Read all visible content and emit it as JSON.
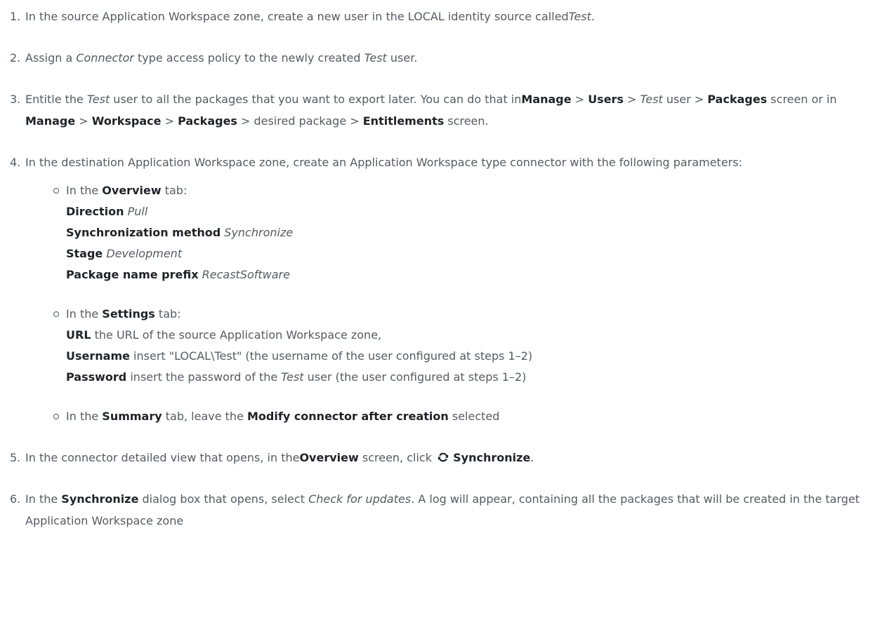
{
  "steps": [
    {
      "num": "1.",
      "t1": "In the source Application Workspace zone, create a new user in the LOCAL identity source called",
      "t2": "Test",
      "t3": "."
    },
    {
      "num": "2.",
      "t1": "Assign a ",
      "t2": "Connector",
      "t3": " type access policy to the newly created ",
      "t4": "Test",
      "t5": " user."
    },
    {
      "num": "3.",
      "t1": "Entitle the ",
      "t2": "Test",
      "t3": " user to all the packages that you want to export later. You can do that in",
      "manage1": "Manage",
      "sep": " > ",
      "users": "Users",
      "test": "Test",
      "user_text": " user > ",
      "packages1": "Packages",
      "t4": " screen or in ",
      "manage2": "Manage",
      "workspace": "Workspace",
      "packages2": "Packages",
      "t5": " > desired package > ",
      "entitlements": "Entitlements",
      "t6": " screen."
    },
    {
      "num": "4.",
      "t1": "In the destination Application Workspace zone, create an Application Workspace type connector with the following parameters:",
      "overview": {
        "pre": "In the ",
        "tab": "Overview",
        "post": " tab:",
        "fields": [
          {
            "label": "Direction",
            "value": "Pull"
          },
          {
            "label": "Synchronization method",
            "value": "Synchronize"
          },
          {
            "label": "Stage",
            "value": "Development"
          },
          {
            "label": "Package name prefix",
            "value": "RecastSoftware"
          }
        ]
      },
      "settings": {
        "pre": "In the ",
        "tab": "Settings",
        "post": " tab:",
        "url_label": "URL",
        "url_text": " the URL of the source Application Workspace zone,",
        "user_label": "Username",
        "user_text": " insert \"LOCAL\\Test\" (the username of the user configured at steps 1–2)",
        "pass_label": "Password",
        "pass_text1": " insert the password of the ",
        "pass_test": "Test",
        "pass_text2": " user (the user configured at steps 1–2)"
      },
      "summary": {
        "pre": "In the ",
        "tab": "Summary",
        "mid": " tab, leave the ",
        "opt": "Modify connector after creation",
        "post": " selected"
      }
    },
    {
      "num": "5.",
      "t1": "In the connector detailed view that opens, in the",
      "overview": "Overview",
      "t2": " screen, click ",
      "sync": "Synchronize",
      "t3": "."
    },
    {
      "num": "6.",
      "t1": "In the ",
      "sync": "Synchronize",
      "t2": " dialog box that opens, select ",
      "check": "Check for updates",
      "t3": ". A log will appear, containing all the packages that will be created in the target Application Workspace zone"
    }
  ],
  "icons": {
    "sync": "sync-icon"
  }
}
